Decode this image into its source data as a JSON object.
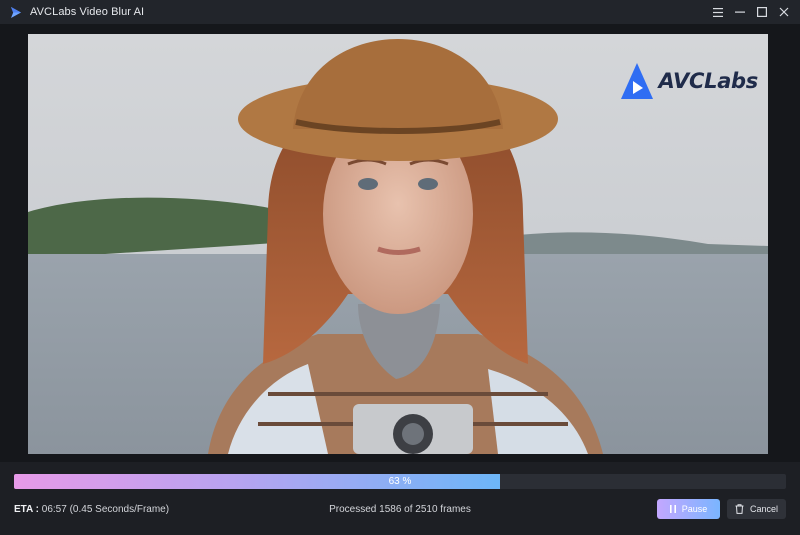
{
  "app": {
    "title": "AVCLabs Video Blur AI",
    "icon": "avclabs-logo-icon",
    "accent": "#6db6f8"
  },
  "window_controls": {
    "menu_icon": "hamburger-menu-icon",
    "minimize_icon": "minimize-icon",
    "maximize_icon": "maximize-icon",
    "close_icon": "close-icon"
  },
  "preview": {
    "watermark_text": "AVCLabs",
    "watermark_icon": "avclabs-play-logo-icon"
  },
  "progress": {
    "percent_value": 63,
    "percent_label": "63 %",
    "gradient_start": "#e79ae8",
    "gradient_end": "#6db6f8"
  },
  "status": {
    "eta_label": "ETA :",
    "eta_value": " 06:57 (0.45 Seconds/Frame)",
    "processed_text": "Processed 1586 of 2510 frames"
  },
  "buttons": {
    "pause_label": "Pause",
    "pause_icon": "pause-icon",
    "cancel_label": "Cancel",
    "cancel_icon": "trash-icon"
  }
}
